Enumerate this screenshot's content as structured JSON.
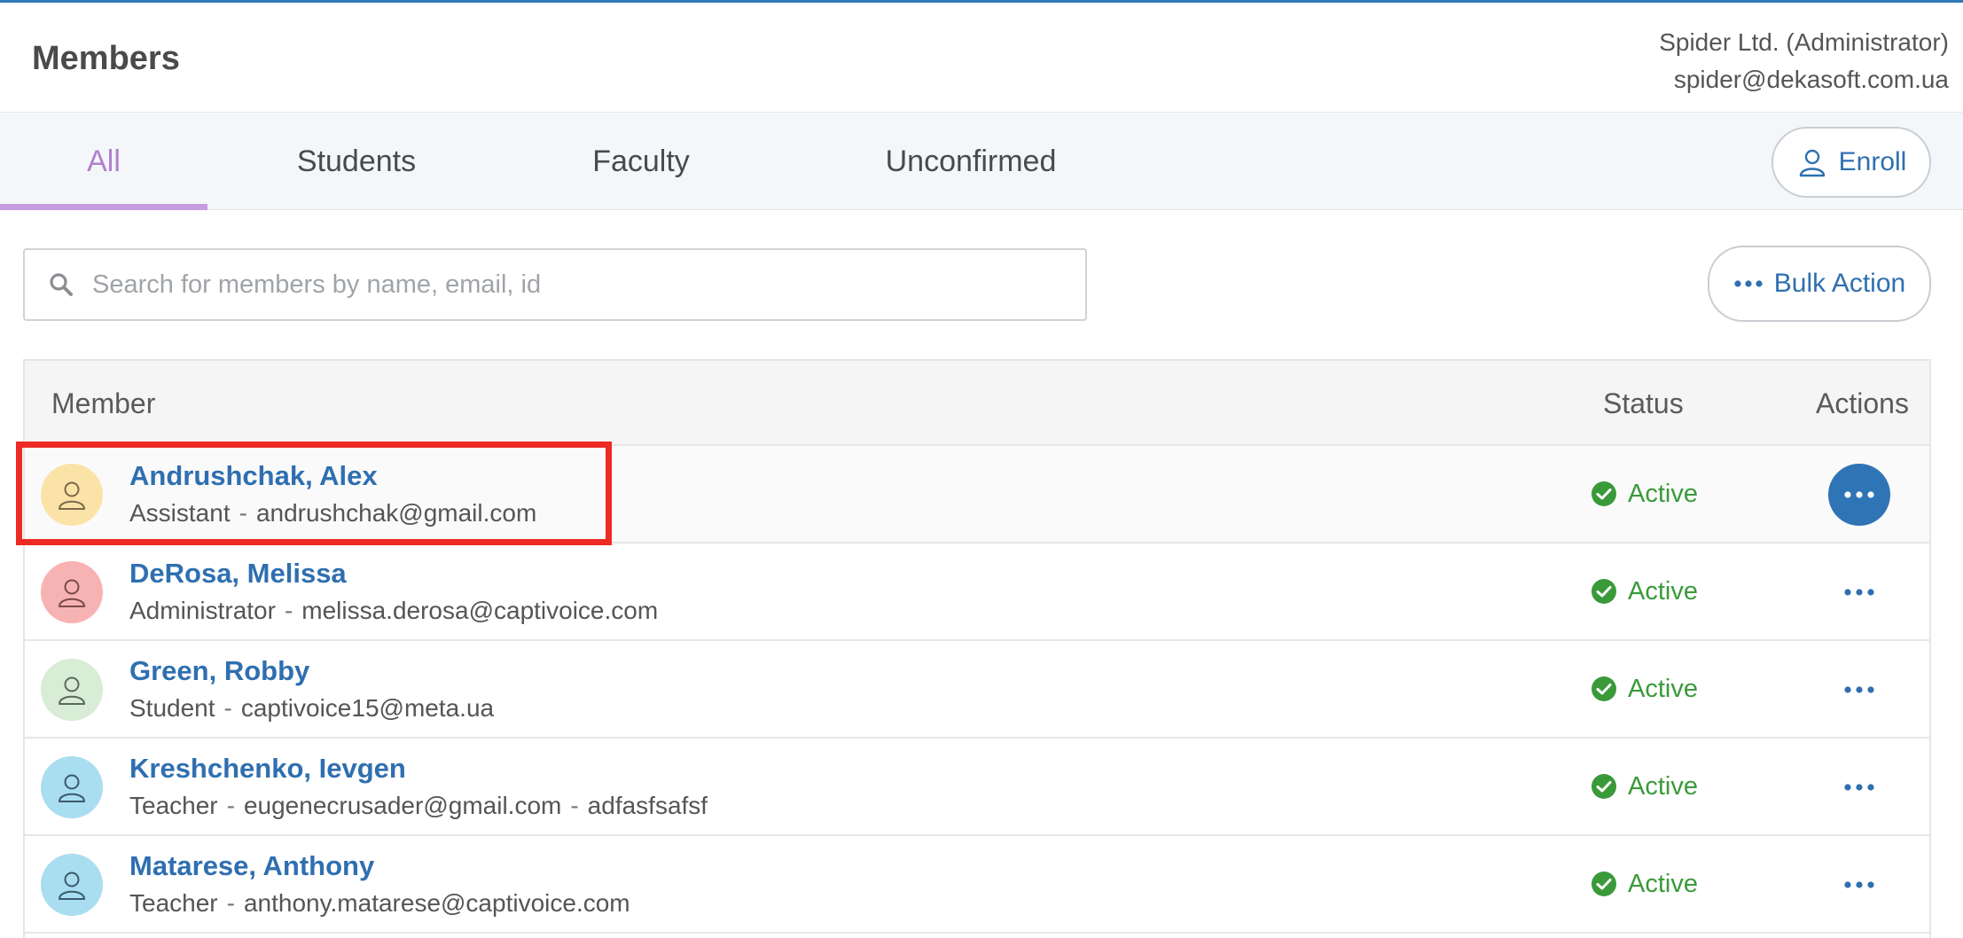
{
  "header": {
    "title": "Members",
    "account_name": "Spider Ltd. (Administrator)",
    "account_email": "spider@dekasoft.com.ua"
  },
  "tabs": [
    {
      "label": "All",
      "active": true
    },
    {
      "label": "Students",
      "active": false
    },
    {
      "label": "Faculty",
      "active": false
    },
    {
      "label": "Unconfirmed",
      "active": false
    }
  ],
  "enroll": {
    "label": "Enroll",
    "icon": "user-icon"
  },
  "bulk_action": {
    "label": "Bulk Action",
    "icon": "ellipsis-icon"
  },
  "search": {
    "placeholder": "Search for members by name, email, id",
    "value": "",
    "icon": "search-icon"
  },
  "table": {
    "columns": {
      "member": "Member",
      "status": "Status",
      "actions": "Actions"
    },
    "rows": [
      {
        "name": "Andrushchak, Alex",
        "role": "Assistant",
        "email": "andrushchak@gmail.com",
        "extra": "",
        "status": "Active",
        "avatar_color": "#fbe3a8"
      },
      {
        "name": "DeRosa, Melissa",
        "role": "Administrator",
        "email": "melissa.derosa@captivoice.com",
        "extra": "",
        "status": "Active",
        "avatar_color": "#f7b3b3"
      },
      {
        "name": "Green, Robby",
        "role": "Student",
        "email": "captivoice15@meta.ua",
        "extra": "",
        "status": "Active",
        "avatar_color": "#d8ecd6"
      },
      {
        "name": "Kreshchenko, Ievgen",
        "role": "Teacher",
        "email": "eugenecrusader@gmail.com",
        "extra": "adfasfsafsf",
        "status": "Active",
        "avatar_color": "#a9def0"
      },
      {
        "name": "Matarese, Anthony",
        "role": "Teacher",
        "email": "anthony.matarese@captivoice.com",
        "extra": "",
        "status": "Active",
        "avatar_color": "#a9def0"
      }
    ]
  },
  "colors": {
    "accent": "#2f6fb0",
    "tab_active": "#b07fcf",
    "status_active": "#3a9a3a",
    "highlight": "#ee2a24"
  }
}
